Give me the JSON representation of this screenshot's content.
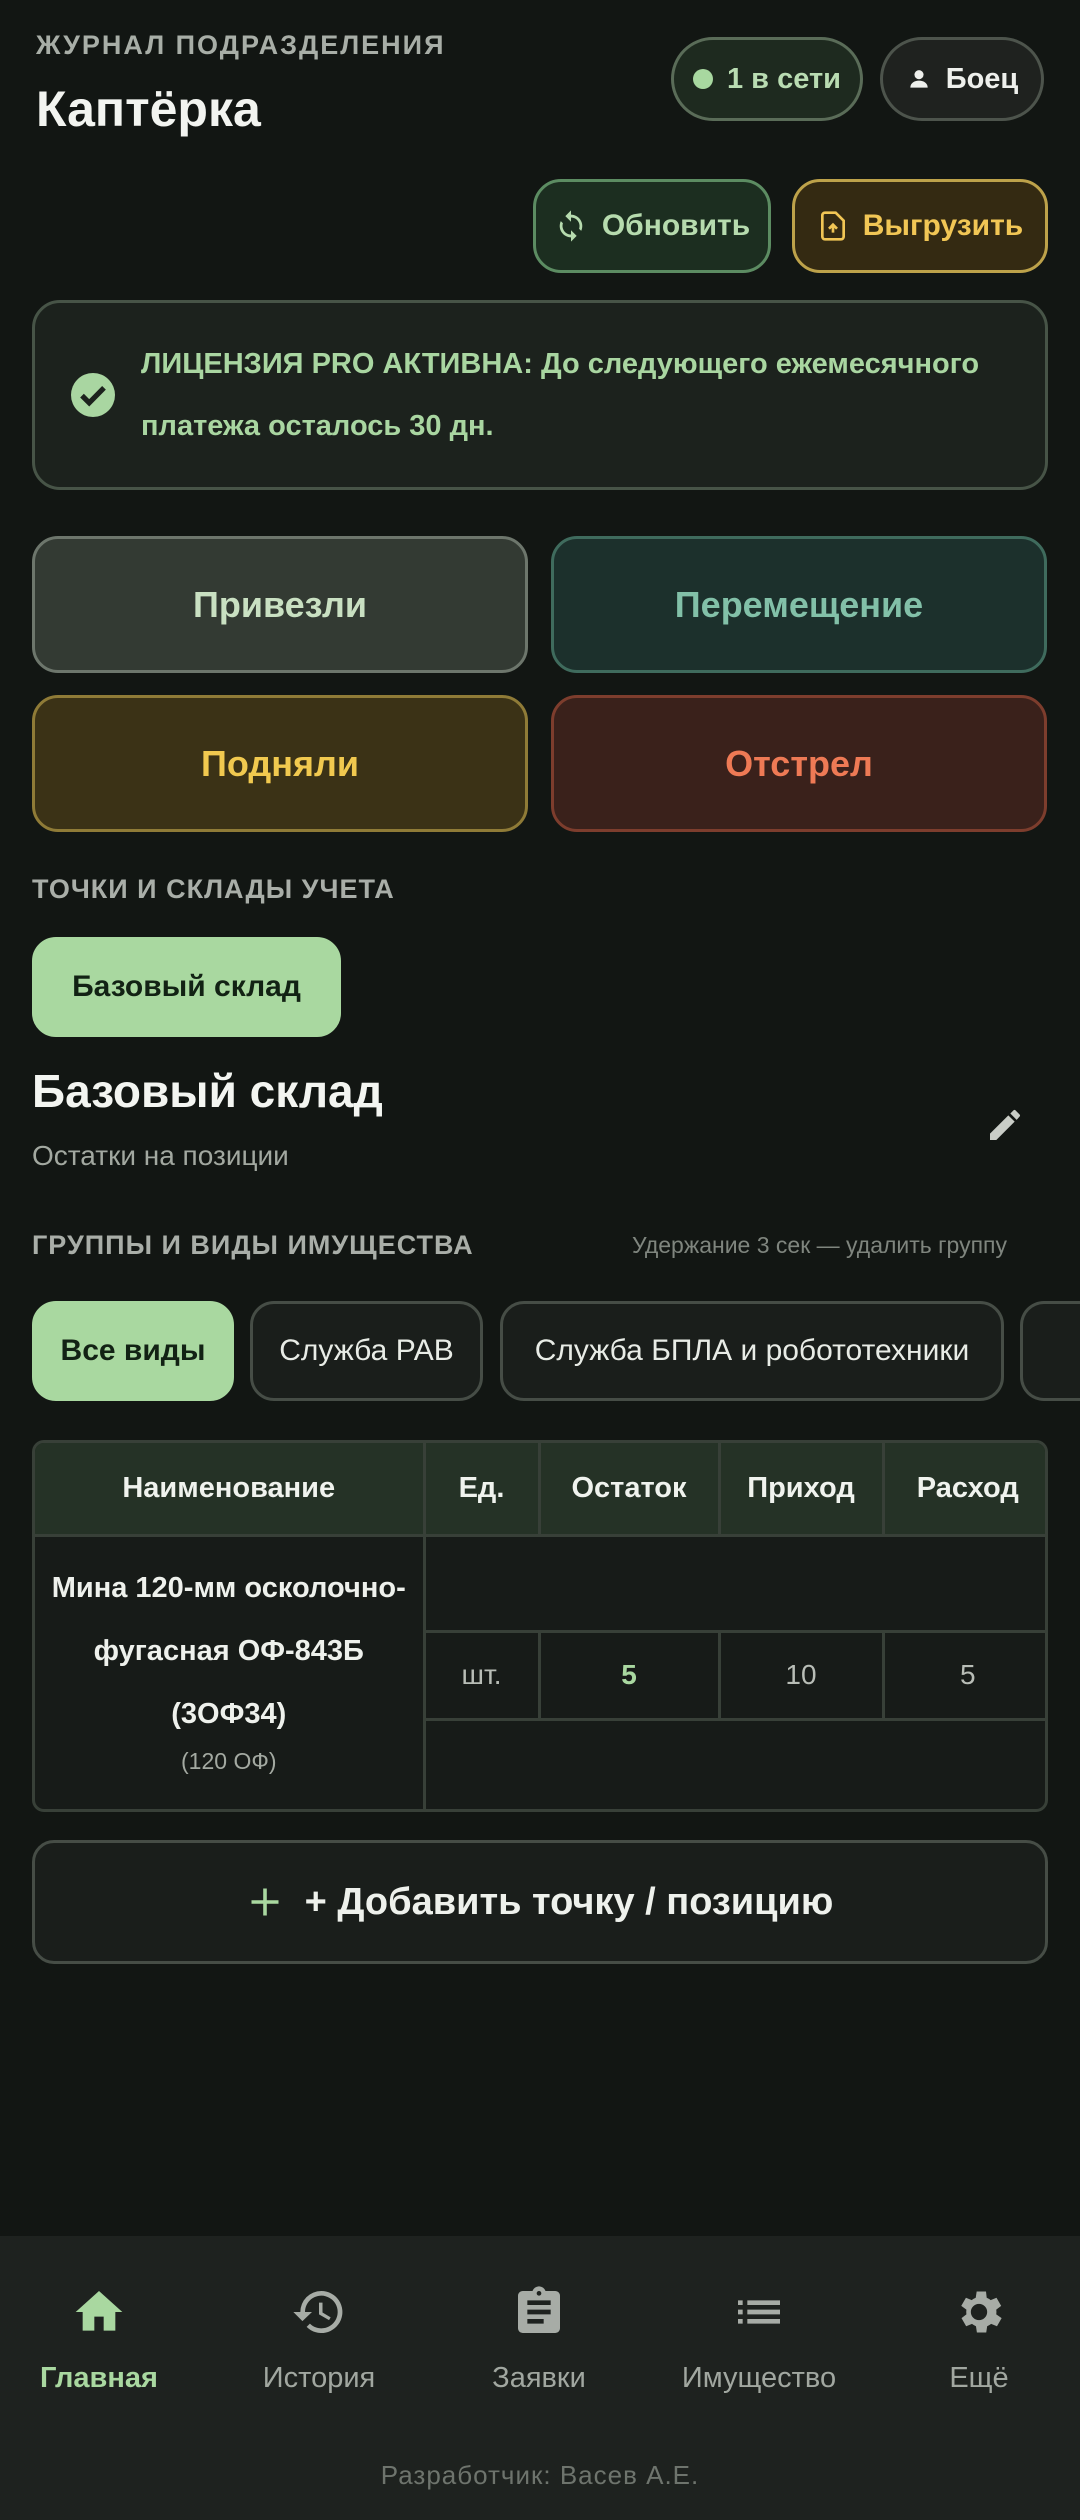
{
  "header": {
    "overline": "ЖУРНАЛ ПОДРАЗДЕЛЕНИЯ",
    "title": "Каптёрка",
    "online_label": "1 в сети",
    "user_label": "Боец",
    "refresh_label": "Обновить",
    "export_label": "Выгрузить"
  },
  "license": {
    "text": "ЛИЦЕНЗИЯ PRO АКТИВНА: До следующего ежемесячного платежа осталось 30 дн."
  },
  "operations": [
    "Привезли",
    "Перемещение",
    "Подняли",
    "Отстрел"
  ],
  "points": {
    "label": "ТОЧКИ И СКЛАДЫ УЧЕТА",
    "items": [
      "Базовый склад"
    ]
  },
  "warehouse": {
    "title": "Базовый склад",
    "subtitle": "Остатки на позиции"
  },
  "groups": {
    "label": "ГРУППЫ И ВИДЫ ИМУЩЕСТВА",
    "hint": "Удержание 3 сек — удалить группу",
    "chips": [
      "Все виды",
      "Служба РАВ",
      "Служба БПЛА и робототехники"
    ]
  },
  "table": {
    "headers": [
      "Наименование",
      "Ед.",
      "Остаток",
      "Приход",
      "Расход"
    ],
    "rows": [
      {
        "name": "Мина 120-мм осколочно-фугасная ОФ-843Б (3ОФ34)",
        "short": "(120 ОФ)",
        "unit": "шт.",
        "remaining": "5",
        "income": "10",
        "expense": "5"
      }
    ]
  },
  "add_button": "+ Добавить точку / позицию",
  "nav": [
    "Главная",
    "История",
    "Заявки",
    "Имущество",
    "Ещё"
  ],
  "footer": "Разработчик: Васев А.Е.",
  "colors": {
    "background": "#121613",
    "accent": "#a9d8a0",
    "export": "#f1c655",
    "danger": "#ee7a55"
  }
}
